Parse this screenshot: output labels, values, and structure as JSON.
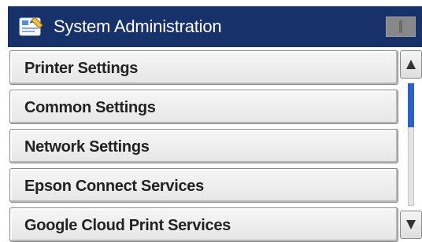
{
  "header": {
    "title": "System Administration",
    "icon": "system-admin-icon",
    "status_icon": "status-indicator-icon",
    "background_color": "#17316b"
  },
  "menu": {
    "items": [
      {
        "label": "Printer Settings"
      },
      {
        "label": "Common Settings"
      },
      {
        "label": "Network Settings"
      },
      {
        "label": "Epson Connect Services"
      },
      {
        "label": "Google Cloud Print Services"
      }
    ]
  },
  "scrollbar": {
    "up_icon": "arrow-up-icon",
    "down_icon": "arrow-down-icon",
    "thumb_color": "#2a5fd0"
  }
}
